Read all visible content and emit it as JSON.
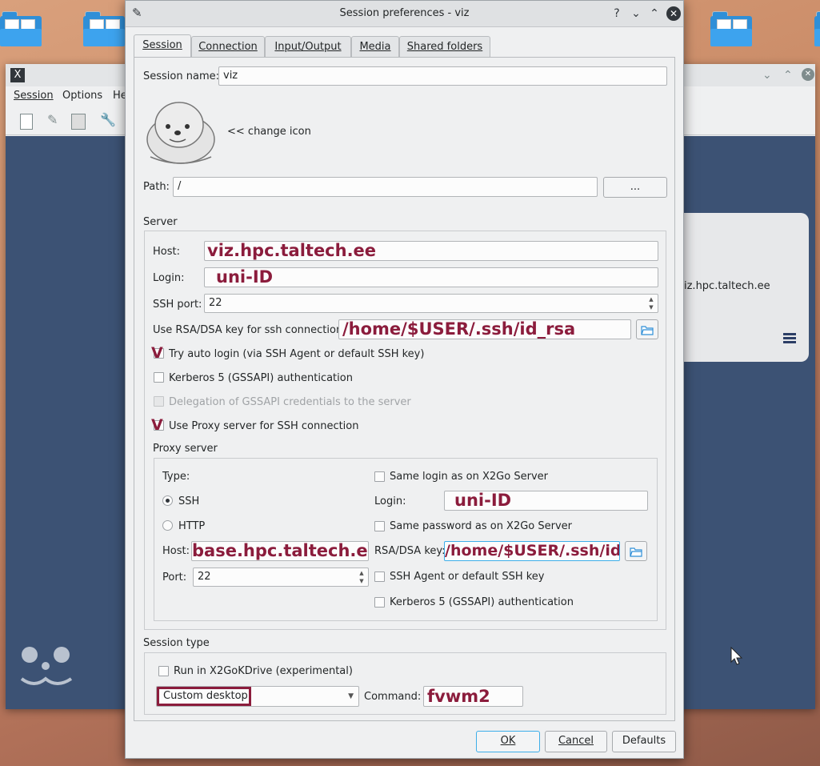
{
  "dialog": {
    "title": "Session preferences - viz",
    "help": "?",
    "min": "⌄",
    "max": "⌃",
    "close": "✕"
  },
  "tabs": [
    "Session",
    "Connection",
    "Input/Output",
    "Media",
    "Shared folders"
  ],
  "session": {
    "name_label": "Session name:",
    "name_value": "viz",
    "change_icon": "<< change icon",
    "path_label": "Path:",
    "path_value": "/",
    "browse": "..."
  },
  "server": {
    "section": "Server",
    "host_label": "Host:",
    "host_value": "viz.hpc.taltech.ee",
    "login_label": "Login:",
    "login_value": "uni-ID",
    "port_label": "SSH port:",
    "port_value": "22",
    "key_label": "Use RSA/DSA key for ssh connection:",
    "key_value": "/home/$USER/.ssh/id_rsa",
    "auto_login": "Try auto login (via SSH Agent or default SSH key)",
    "kerberos": "Kerberos 5 (GSSAPI) authentication",
    "delegation": "Delegation of GSSAPI credentials to the server",
    "use_proxy": "Use Proxy server for SSH connection",
    "check_mark": "V"
  },
  "proxy": {
    "section": "Proxy server",
    "type_label": "Type:",
    "ssh": "SSH",
    "http": "HTTP",
    "host_label": "Host:",
    "host_value": "base.hpc.taltech.ee",
    "port_label": "Port:",
    "port_value": "22",
    "same_login": "Same login as on X2Go Server",
    "login_label": "Login:",
    "login_value": "uni-ID",
    "same_password": "Same password as on X2Go Server",
    "key_label": "RSA/DSA key:",
    "key_value": "/home/$USER/.ssh/id_rsa",
    "ssh_agent": "SSH Agent or default SSH key",
    "kerberos": "Kerberos 5 (GSSAPI) authentication"
  },
  "session_type": {
    "section": "Session type",
    "kdrive": "Run in X2GoKDrive (experimental)",
    "selected": "Custom desktop",
    "command_label": "Command:",
    "command_value": "fvwm2"
  },
  "footer": {
    "ok": "OK",
    "cancel": "Cancel",
    "defaults": "Defaults"
  },
  "background": {
    "menu_session": "Session",
    "menu_options": "Options",
    "menu_help": "He",
    "card_host": "iz.hpc.taltech.ee"
  },
  "colors": {
    "annotation": "#8b1c3c",
    "focus": "#3daee9",
    "folder": "#2f8fd8"
  }
}
